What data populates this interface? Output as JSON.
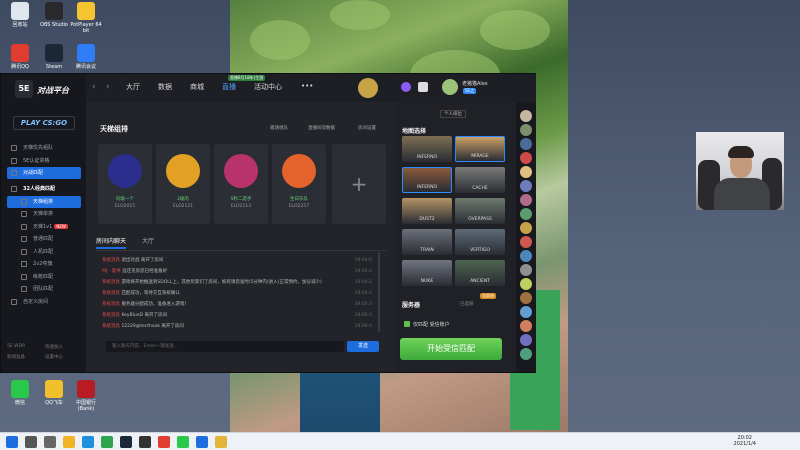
{
  "desktop": {
    "icons": [
      {
        "label": "回收站",
        "color": "#dfe6ee",
        "icon": "recycle-bin-icon"
      },
      {
        "label": "OBS Studio",
        "color": "#2a2a2e",
        "icon": "obs-icon"
      },
      {
        "label": "PotPlayer 64 bit",
        "color": "#f5c531",
        "icon": "potplayer-icon"
      },
      {
        "label": "腾讯QQ",
        "color": "#e03c2f",
        "icon": "qq-icon"
      },
      {
        "label": "Steam",
        "color": "#1b2838",
        "icon": "steam-icon"
      },
      {
        "label": "腾讯会议",
        "color": "#2e7cf6",
        "icon": "tencent-meeting-icon"
      },
      {
        "label": "微信",
        "color": "#2ac84a",
        "icon": "wechat-icon"
      },
      {
        "label": "QQ飞车",
        "color": "#f2c02c",
        "icon": "qq-speed-icon"
      },
      {
        "label": "中国银行\n(Bank)",
        "color": "#b81c22",
        "icon": "bank-of-china-icon"
      }
    ]
  },
  "app": {
    "logo_text": "对战平台",
    "logo_mark": "5E",
    "play_label": "PLAY CS:GO",
    "sidebar": [
      {
        "label": "天梯优先组队",
        "kind": "item"
      },
      {
        "label": "5E认证资格",
        "kind": "item"
      },
      {
        "label": "对战匹配",
        "kind": "item",
        "selected": true
      },
      {
        "label": "32人经典匹配",
        "kind": "hdr"
      },
      {
        "label": "天梯组排",
        "kind": "sub",
        "selected": true
      },
      {
        "label": "天梯单排",
        "kind": "sub"
      },
      {
        "label": "天梯1v1",
        "kind": "sub",
        "badge": "NEW"
      },
      {
        "label": "普通匹配",
        "kind": "sub"
      },
      {
        "label": "人机匹配",
        "kind": "sub"
      },
      {
        "label": "2v2夺旗",
        "kind": "sub"
      },
      {
        "label": "练枪匹配",
        "kind": "sub"
      },
      {
        "label": "团队匹配",
        "kind": "sub"
      },
      {
        "label": "自定义房间",
        "kind": "item"
      }
    ],
    "sidebar_footer": [
      "5E WDR",
      "快速加入",
      "新闻准备",
      "设置中心"
    ],
    "nav_tabs": [
      {
        "label": "大厅",
        "active": false
      },
      {
        "label": "数据",
        "active": false
      },
      {
        "label": "商城",
        "active": false
      },
      {
        "label": "直播",
        "active": true
      },
      {
        "label": "活动中心",
        "active": false
      }
    ],
    "live_badge": "直播8月18年(生游",
    "more_label": "•••",
    "username": "老猪猫Alex",
    "user_tag": "5E之",
    "section_title": "天梯组排",
    "tool_links": [
      "邀请组队",
      "直播间双数据",
      "房间设置"
    ],
    "players": [
      {
        "tag": "同级一个",
        "elo": "ELO2015",
        "color": "#2b2e8c"
      },
      {
        "tag": "2级的",
        "elo": "ELO2121",
        "color": "#e2a125"
      },
      {
        "tag": "S秒二选手",
        "elo": "ELO2113",
        "color": "#b8336a"
      },
      {
        "tag": "生日乐队",
        "elo": "ELO2257",
        "color": "#e4622c"
      }
    ],
    "add_label": "+",
    "chat_tabs": [
      "房间内聊天",
      "大厅"
    ],
    "chat_lines": [
      {
        "sys": "系统消息",
        "text": "退出对战 离开了房间",
        "time": "19:04:0"
      },
      {
        "sys": "MJ - 夏季",
        "text": "远还见房您已经准备好",
        "time": "19:04:2"
      },
      {
        "sys": "系统消息",
        "text": "游戏将开始推送到SDOLL上，其他玩家们了房间，如有请您准时(5分钟内)进入(正常预约，加分减少)",
        "time": "19:04:2"
      },
      {
        "sys": "系统消息",
        "text": "匹配成功，等待交互系统确认",
        "time": "19:04:2"
      },
      {
        "sys": "系统消息",
        "text": "服务器分配成功，准备进入游戏！",
        "time": "19:05:3"
      },
      {
        "sys": "系统消息",
        "text": "KeyBlueD 离开了房间",
        "time": "19:06:3"
      },
      {
        "sys": "系统消息",
        "text": "12229@tecthook 离开了房间",
        "time": "19:06:4"
      }
    ],
    "chat_placeholder": "输入聊天内容，Enter一键发送...",
    "send_label": "发送",
    "personal_rank_label": "个人排位",
    "map_section": "地图选择",
    "maps": [
      {
        "name": "INFERNO",
        "selected": false,
        "color": "#7e6f55"
      },
      {
        "name": "MIRAGE",
        "selected": true,
        "color": "#caa067"
      },
      {
        "name": "INFERNO",
        "selected": true,
        "color": "#8a5b3a"
      },
      {
        "name": "CACHE",
        "selected": false,
        "color": "#7a7a78"
      },
      {
        "name": "DUST2",
        "selected": false,
        "color": "#b39466"
      },
      {
        "name": "OVERPASS",
        "selected": false,
        "color": "#6f7a6e"
      },
      {
        "name": "TRAIN",
        "selected": false,
        "color": "#6b7078"
      },
      {
        "name": "VERTIGO",
        "selected": false,
        "color": "#5d6b78"
      },
      {
        "name": "NUKE",
        "selected": false,
        "color": "#707580"
      },
      {
        "name": "ANCIENT",
        "selected": false,
        "color": "#4e6450"
      }
    ],
    "server_section": "服务器",
    "server_note": "已选择",
    "server_badge": "全部选",
    "pref_label": "仅匹配 受信账户",
    "match_button": "开始受信匹配"
  },
  "taskbar": {
    "time": "20:02",
    "date": "2021/1/4",
    "apps": [
      "start-icon",
      "search-icon",
      "task-view-icon",
      "explorer-icon",
      "edge-icon",
      "chrome-icon",
      "steam-icon",
      "obs-icon",
      "qq-icon",
      "wechat-icon",
      "5e-icon",
      "folder-icon"
    ]
  }
}
